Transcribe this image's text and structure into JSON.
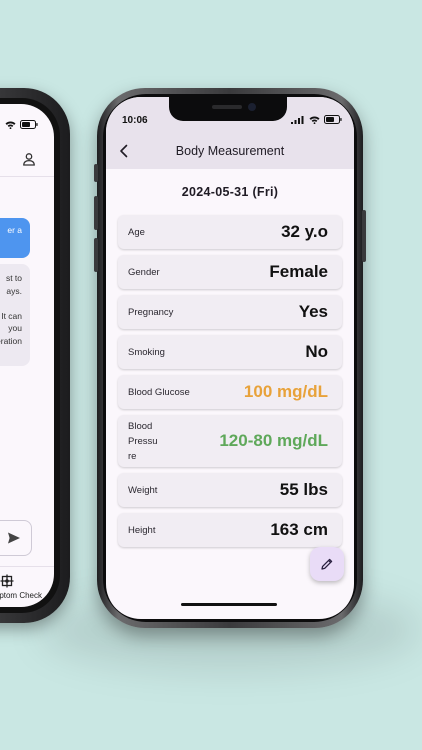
{
  "colors": {
    "background": "#c9e7e3",
    "appbar": "#e8e2ec",
    "card": "#f1edf3",
    "glucose": "#e8a23a",
    "pressure": "#5fa85a",
    "fab": "#e9dcf7",
    "chat_bubble": "#4e95ef"
  },
  "left_phone": {
    "bubble_blue_text": "er a",
    "bubble_grey_lines": [
      "st to",
      "ays.",
      "",
      "s. It can",
      "you",
      "deration"
    ],
    "tab_label": "ptom Check",
    "icons": [
      "person-icon",
      "send-icon",
      "symptom-check-icon"
    ]
  },
  "status_bar": {
    "time": "10:06"
  },
  "app_bar": {
    "title": "Body Measurement",
    "back_icon": "chevron-left-icon"
  },
  "date": "2024-05-31 (Fri)",
  "measurements": [
    {
      "label": "Age",
      "value": "32 y.o"
    },
    {
      "label": "Gender",
      "value": "Female"
    },
    {
      "label": "Pregnancy",
      "value": "Yes"
    },
    {
      "label": "Smoking",
      "value": "No"
    },
    {
      "label": "Blood Glucose",
      "value": "100 mg/dL"
    },
    {
      "label": "Blood Pressure",
      "label_lines": [
        "Blood",
        "Pressu",
        "re"
      ],
      "value": "120-80 mg/dL"
    },
    {
      "label": "Weight",
      "value": "55 lbs"
    },
    {
      "label": "Height",
      "value": "163 cm"
    }
  ],
  "fab": {
    "icon": "edit-pencil-icon"
  }
}
